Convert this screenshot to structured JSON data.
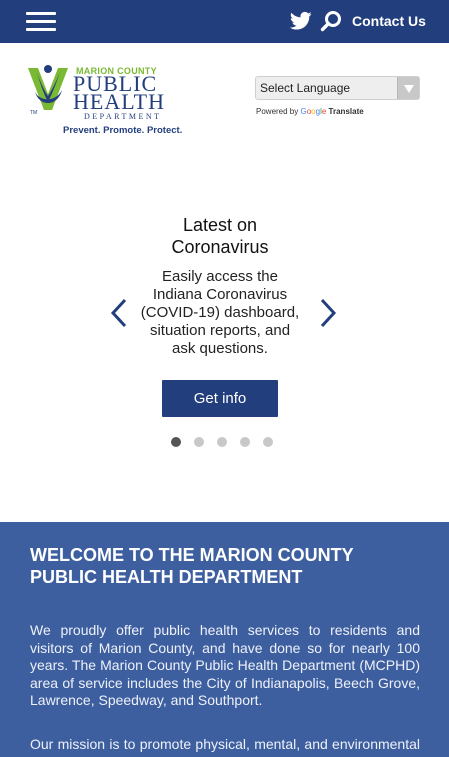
{
  "header": {
    "contact_label": "Contact Us",
    "bg_color": "#233e7d"
  },
  "logo": {
    "county": "MARION COUNTY",
    "public": "PUBLIC",
    "health": "HEALTH",
    "department": "DEPARTMENT",
    "tagline": "Prevent. Promote. Protect."
  },
  "translate": {
    "selected": "Select Language",
    "powered_by": "Powered by",
    "google": [
      "G",
      "o",
      "o",
      "g",
      "l",
      "e"
    ],
    "translate_label": "Translate"
  },
  "carousel": {
    "title": "Latest on Coronavirus",
    "body": "Easily access the Indiana Coronavirus (COVID-19) dashboard, situation reports, and ask questions.",
    "button_label": "Get info",
    "slide_count": 5,
    "active_index": 0
  },
  "welcome": {
    "title": "WELCOME TO THE MARION COUNTY PUBLIC HEALTH DEPARTMENT",
    "paragraph1": "We proudly offer public health services to residents and visitors of Marion County, and have done so for nearly 100 years. The Marion County Public Health Department (MCPHD) area of service includes the City of Indianapolis, Beech Grove, Lawrence, Speedway, and Southport.",
    "paragraph2": "Our mission is to promote physical, mental, and environmental health, prevent and protect against",
    "bg_color": "#3d5fa0"
  },
  "icons": [
    "menu-icon",
    "twitter-icon",
    "search-icon",
    "chevron-left-icon",
    "chevron-right-icon",
    "dropdown-arrow-icon"
  ]
}
